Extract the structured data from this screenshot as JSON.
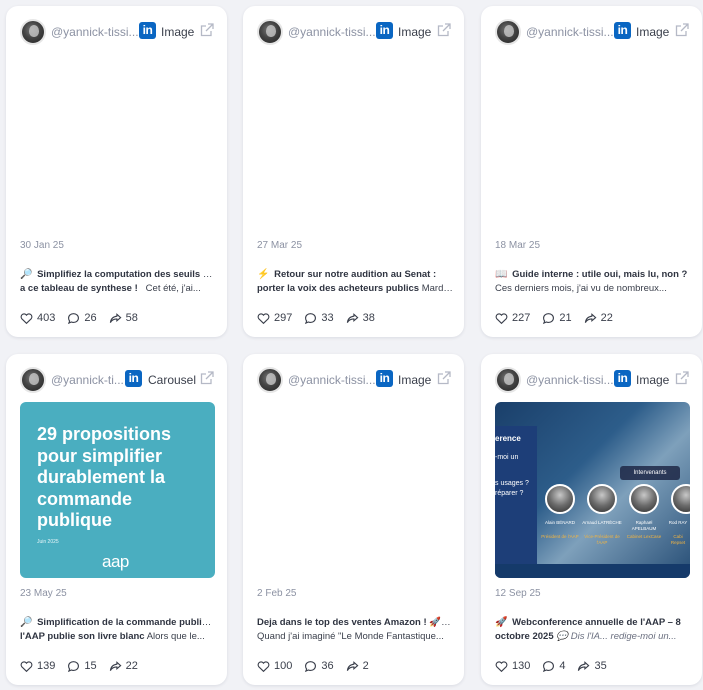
{
  "colors": {
    "background": "#f1f2f6",
    "card": "#ffffff",
    "linkedin": "#0a66c2",
    "muted": "#8c92a3",
    "aap_cover": "#4aaec0"
  },
  "cards": [
    {
      "handle": "@yannick-tissi...",
      "type": "Image",
      "date": "30 Jan 25",
      "emoji": "🔎",
      "line1": "Simplifiez la computation des seuils grâce",
      "line2_bold": "a ce tableau de synthese !",
      "line2_rest": "Cet été, j'ai...",
      "likes": "403",
      "comments": "26",
      "shares": "58"
    },
    {
      "handle": "@yannick-tissi...",
      "type": "Image",
      "date": "27 Mar 25",
      "emoji": "⚡",
      "line1": "Retour sur notre audition au Senat :",
      "line2_bold": "porter la voix des acheteurs publics",
      "line2_rest": "Mardi...",
      "likes": "297",
      "comments": "33",
      "shares": "38"
    },
    {
      "handle": "@yannick-tissi...",
      "type": "Image",
      "date": "18 Mar 25",
      "emoji": "📖",
      "line1": "Guide interne : utile oui, mais lu, non ?",
      "line2_bold": "",
      "line2_rest": "Ces derniers mois, j'ai vu de nombreux...",
      "likes": "227",
      "comments": "21",
      "shares": "22"
    },
    {
      "handle": "@yannick-ti...",
      "type": "Carousel",
      "date": "23 May 25",
      "emoji": "🔎",
      "line1": "Simplification de la commande publique :",
      "line2_bold": "l'AAP publie son livre blanc",
      "line2_rest": "Alors que le...",
      "likes": "139",
      "comments": "15",
      "shares": "22",
      "cover": {
        "headline": "29 propositions pour simplifier durablement la commande publique",
        "date": "Juin 2025",
        "brand": "aap"
      }
    },
    {
      "handle": "@yannick-tissi...",
      "type": "Image",
      "date": "2 Feb 25",
      "emoji": "",
      "line1": "Deja dans le top des ventes Amazon ! 🚀 📖",
      "line2_bold": "",
      "line2_rest": "Quand j'ai imaginé \"Le Monde Fantastique...",
      "likes": "100",
      "comments": "36",
      "shares": "2"
    },
    {
      "handle": "@yannick-tissi...",
      "type": "Image",
      "date": "12 Sep 25",
      "emoji": "🚀",
      "line1": "Webconference annuelle de l'AAP – 8",
      "line2_bold": "octobre 2025",
      "line2_rest": "💬 Dis l'IA... redige-moi un...",
      "likes": "130",
      "comments": "4",
      "shares": "35",
      "cover": {
        "title": "erence",
        "l1": "-moi un",
        "l2": "s usages ?",
        "l3": "réparer ?",
        "badge": "Intervenants",
        "s1_name": "Alain BÉNARD",
        "s1_role": "Président de l'AAP",
        "s2_name": "Arnaud LATRÈCHE",
        "s2_role": "Vice-Président de l'AAP",
        "s3_name": "Raphaël APELBAUM",
        "s3_role": "Cabinet LexCase",
        "s4_name": "Rod RAY",
        "s4_role": "Cabi Repset"
      }
    }
  ]
}
